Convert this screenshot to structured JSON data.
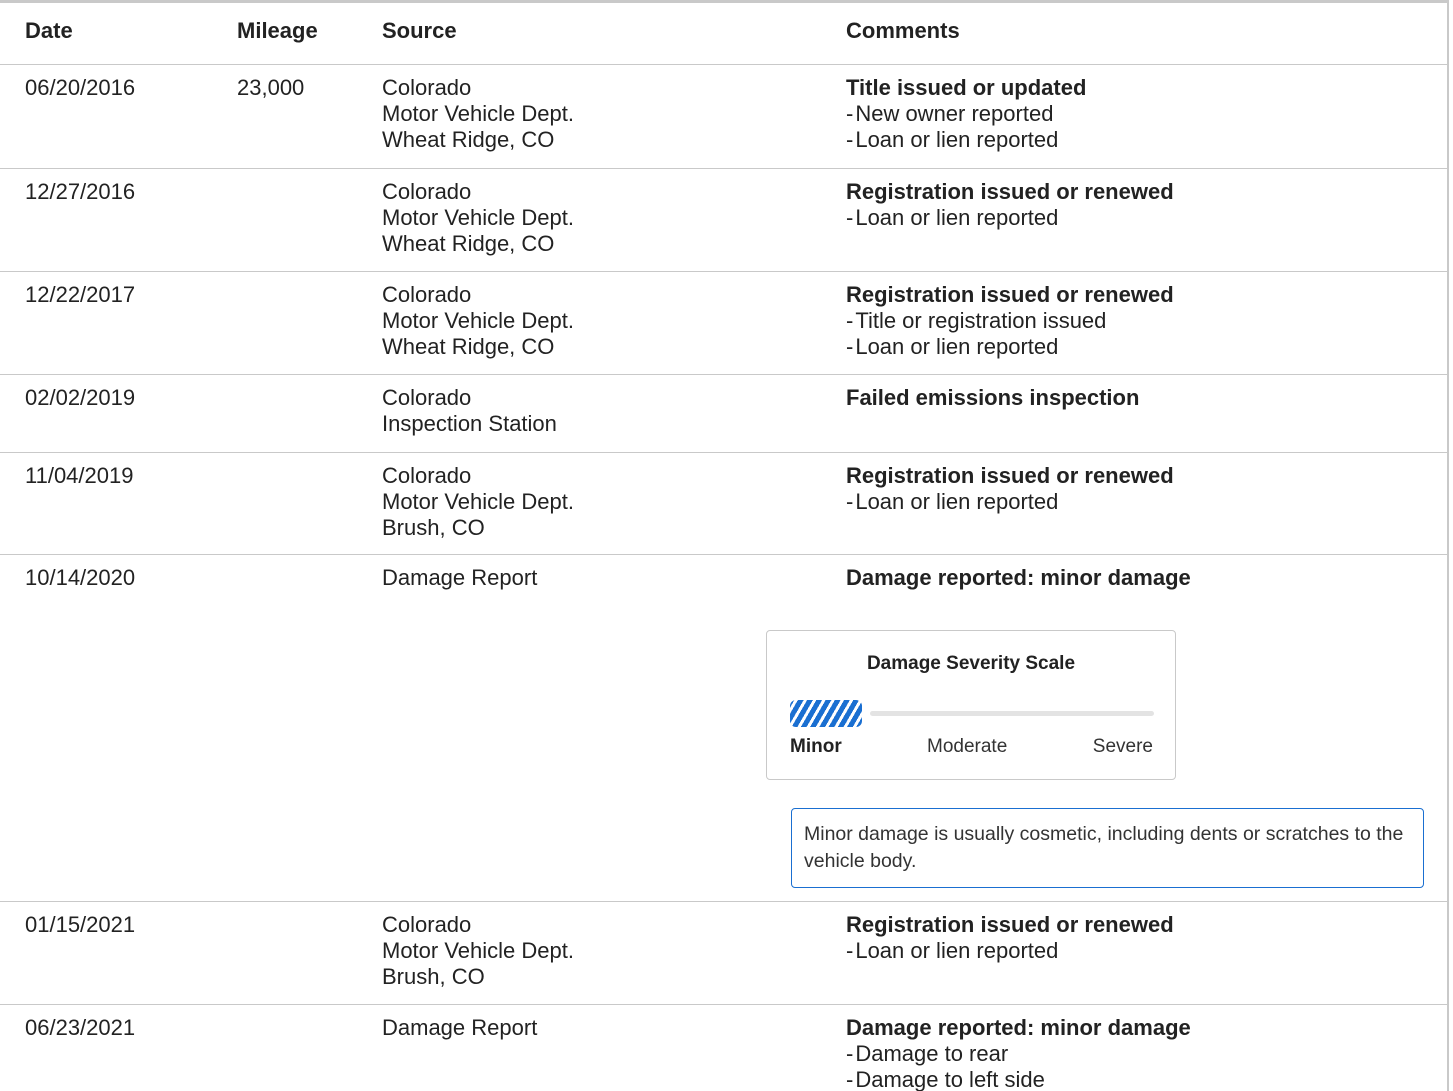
{
  "headers": {
    "date": "Date",
    "mileage": "Mileage",
    "source": "Source",
    "comments": "Comments"
  },
  "rows": [
    {
      "date": "06/20/2016",
      "mileage": "23,000",
      "source": [
        "Colorado",
        "Motor Vehicle Dept.",
        "Wheat Ridge, CO"
      ],
      "title": "Title issued or updated",
      "bullets": [
        "New owner reported",
        "Loan or lien reported"
      ]
    },
    {
      "date": "12/27/2016",
      "mileage": "",
      "source": [
        "Colorado",
        "Motor Vehicle Dept.",
        "Wheat Ridge, CO"
      ],
      "title": "Registration issued or renewed",
      "bullets": [
        "Loan or lien reported"
      ]
    },
    {
      "date": "12/22/2017",
      "mileage": "",
      "source": [
        "Colorado",
        "Motor Vehicle Dept.",
        "Wheat Ridge, CO"
      ],
      "title": "Registration issued or renewed",
      "bullets": [
        "Title or registration issued",
        "Loan or lien reported"
      ]
    },
    {
      "date": "02/02/2019",
      "mileage": "",
      "source": [
        "Colorado",
        "Inspection Station"
      ],
      "title": "Failed emissions inspection",
      "bullets": []
    },
    {
      "date": "11/04/2019",
      "mileage": "",
      "source": [
        "Colorado",
        "Motor Vehicle Dept.",
        "Brush, CO"
      ],
      "title": "Registration issued or renewed",
      "bullets": [
        "Loan or lien reported"
      ]
    },
    {
      "date": "10/14/2020",
      "mileage": "",
      "source": [
        "Damage Report"
      ],
      "title": "Damage reported: minor damage",
      "bullets": [],
      "severity": {
        "title": "Damage Severity Scale",
        "level": "Minor",
        "labels": [
          "Minor",
          "Moderate",
          "Severe"
        ],
        "info": "Minor damage is usually cosmetic, including dents or scratches to the vehicle body."
      }
    },
    {
      "date": "01/15/2021",
      "mileage": "",
      "source": [
        "Colorado",
        "Motor Vehicle Dept.",
        "Brush, CO"
      ],
      "title": "Registration issued or renewed",
      "bullets": [
        "Loan or lien reported"
      ]
    },
    {
      "date": "06/23/2021",
      "mileage": "",
      "source": [
        "Damage Report"
      ],
      "title": "Damage reported: minor damage",
      "bullets": [
        "Damage to rear",
        "Damage to left side"
      ]
    }
  ],
  "colors": {
    "accent": "#1a6fd1",
    "border": "#c9c9c9",
    "text": "#222222"
  }
}
